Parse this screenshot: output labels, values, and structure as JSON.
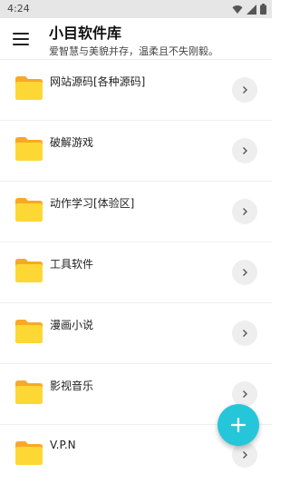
{
  "status_bar": {
    "time": "4:24",
    "icons": [
      "wifi-icon",
      "signal-icon",
      "battery-icon"
    ]
  },
  "app_bar": {
    "title": "小目软件库",
    "subtitle": "爱智慧与美貌并存，温柔且不失刚毅。",
    "menu_icon": "menu-icon"
  },
  "list": {
    "items": [
      {
        "label": "网站源码[各种源码]",
        "icon": "folder-icon",
        "action_icon": "chevron-right-icon"
      },
      {
        "label": "破解游戏",
        "icon": "folder-icon",
        "action_icon": "chevron-right-icon"
      },
      {
        "label": "动作学习[体验区]",
        "icon": "folder-icon",
        "action_icon": "chevron-right-icon"
      },
      {
        "label": "工具软件",
        "icon": "folder-icon",
        "action_icon": "chevron-right-icon"
      },
      {
        "label": "漫画小说",
        "icon": "folder-icon",
        "action_icon": "chevron-right-icon"
      },
      {
        "label": "影视音乐",
        "icon": "folder-icon",
        "action_icon": "chevron-right-icon"
      },
      {
        "label": "V.P.N",
        "icon": "folder-icon",
        "action_icon": "chevron-right-icon"
      }
    ]
  },
  "fab": {
    "icon": "plus-icon",
    "color": "#26c6da"
  },
  "colors": {
    "folder": "#fdd835",
    "folder_tab": "#f9a825",
    "accent": "#26c6da"
  }
}
